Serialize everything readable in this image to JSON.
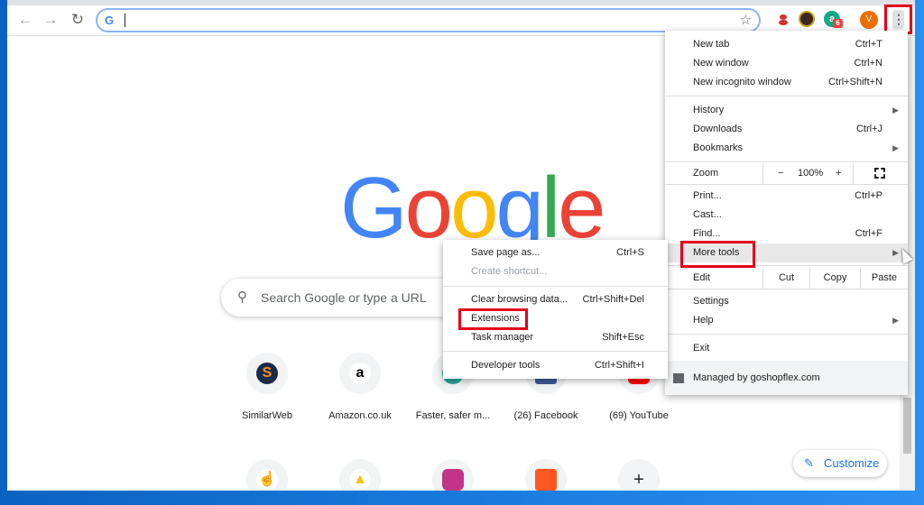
{
  "browser": {
    "omnibox": {
      "value": "",
      "icon": "G"
    },
    "profile_initial": "V",
    "extension_badge": "6"
  },
  "newtab": {
    "logo": [
      {
        "ch": "G",
        "color": "#4285F4"
      },
      {
        "ch": "o",
        "color": "#EA4335"
      },
      {
        "ch": "o",
        "color": "#FBBC05"
      },
      {
        "ch": "g",
        "color": "#4285F4"
      },
      {
        "ch": "l",
        "color": "#34A853"
      },
      {
        "ch": "e",
        "color": "#EA4335"
      }
    ],
    "search_placeholder": "Search Google or type a URL",
    "tiles_row1": [
      "SimilarWeb",
      "Amazon.co.uk",
      "Faster, safer m...",
      "(26) Facebook",
      "(69) YouTube"
    ],
    "customize_label": "Customize"
  },
  "menu": {
    "new_tab": {
      "label": "New tab",
      "shortcut": "Ctrl+T"
    },
    "new_window": {
      "label": "New window",
      "shortcut": "Ctrl+N"
    },
    "new_incognito": {
      "label": "New incognito window",
      "shortcut": "Ctrl+Shift+N"
    },
    "history": {
      "label": "History"
    },
    "downloads": {
      "label": "Downloads",
      "shortcut": "Ctrl+J"
    },
    "bookmarks": {
      "label": "Bookmarks"
    },
    "zoom": {
      "label": "Zoom",
      "minus": "−",
      "value": "100%",
      "plus": "+"
    },
    "print": {
      "label": "Print...",
      "shortcut": "Ctrl+P"
    },
    "cast": {
      "label": "Cast..."
    },
    "find": {
      "label": "Find...",
      "shortcut": "Ctrl+F"
    },
    "more_tools": {
      "label": "More tools"
    },
    "edit": {
      "label": "Edit",
      "cut": "Cut",
      "copy": "Copy",
      "paste": "Paste"
    },
    "settings": {
      "label": "Settings"
    },
    "help": {
      "label": "Help"
    },
    "exit": {
      "label": "Exit"
    },
    "managed": {
      "label": "Managed by goshopflex.com"
    }
  },
  "submenu": {
    "save_page": {
      "label": "Save page as...",
      "shortcut": "Ctrl+S"
    },
    "create_shortcut": {
      "label": "Create shortcut..."
    },
    "clear_data": {
      "label": "Clear browsing data...",
      "shortcut": "Ctrl+Shift+Del"
    },
    "extensions": {
      "label": "Extensions"
    },
    "task_manager": {
      "label": "Task manager",
      "shortcut": "Shift+Esc"
    },
    "dev_tools": {
      "label": "Developer tools",
      "shortcut": "Ctrl+Shift+I"
    }
  },
  "colors": {
    "highlight_red": "#E3001B",
    "accent_blue": "#1A73E8"
  }
}
